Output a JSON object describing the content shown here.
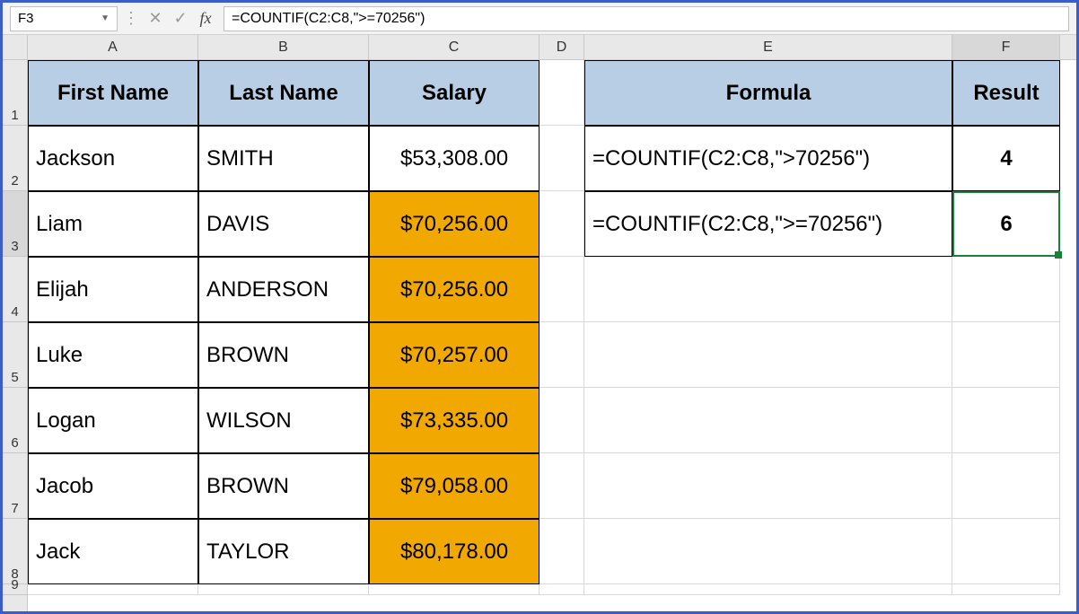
{
  "namebox": "F3",
  "formula_bar": "=COUNTIF(C2:C8,\">=70256\")",
  "col_labels": {
    "A": "A",
    "B": "B",
    "C": "C",
    "D": "D",
    "E": "E",
    "F": "F"
  },
  "row_labels": [
    "1",
    "2",
    "3",
    "4",
    "5",
    "6",
    "7",
    "8",
    "9"
  ],
  "headers": {
    "A": "First Name",
    "B": "Last Name",
    "C": "Salary",
    "E": "Formula",
    "F": "Result"
  },
  "table": [
    {
      "first": "Jackson",
      "last": "SMITH",
      "salary": "$53,308.00",
      "hl": false
    },
    {
      "first": "Liam",
      "last": "DAVIS",
      "salary": "$70,256.00",
      "hl": true
    },
    {
      "first": "Elijah",
      "last": "ANDERSON",
      "salary": "$70,256.00",
      "hl": true
    },
    {
      "first": "Luke",
      "last": "BROWN",
      "salary": "$70,257.00",
      "hl": true
    },
    {
      "first": "Logan",
      "last": "WILSON",
      "salary": "$73,335.00",
      "hl": true
    },
    {
      "first": "Jacob",
      "last": "BROWN",
      "salary": "$79,058.00",
      "hl": true
    },
    {
      "first": "Jack",
      "last": "TAYLOR",
      "salary": "$80,178.00",
      "hl": true
    }
  ],
  "results": [
    {
      "formula": "=COUNTIF(C2:C8,\">70256\")",
      "result": "4"
    },
    {
      "formula": "=COUNTIF(C2:C8,\">=70256\")",
      "result": "6"
    }
  ],
  "selected_cell": "F3",
  "chart_data": {
    "type": "table",
    "columns": [
      "First Name",
      "Last Name",
      "Salary"
    ],
    "rows": [
      [
        "Jackson",
        "SMITH",
        53308.0
      ],
      [
        "Liam",
        "DAVIS",
        70256.0
      ],
      [
        "Elijah",
        "ANDERSON",
        70256.0
      ],
      [
        "Luke",
        "BROWN",
        70257.0
      ],
      [
        "Logan",
        "WILSON",
        73335.0
      ],
      [
        "Jacob",
        "BROWN",
        79058.0
      ],
      [
        "Jack",
        "TAYLOR",
        80178.0
      ]
    ],
    "side_table": {
      "columns": [
        "Formula",
        "Result"
      ],
      "rows": [
        [
          "=COUNTIF(C2:C8,\">70256\")",
          4
        ],
        [
          "=COUNTIF(C2:C8,\">=70256\")",
          6
        ]
      ]
    }
  }
}
